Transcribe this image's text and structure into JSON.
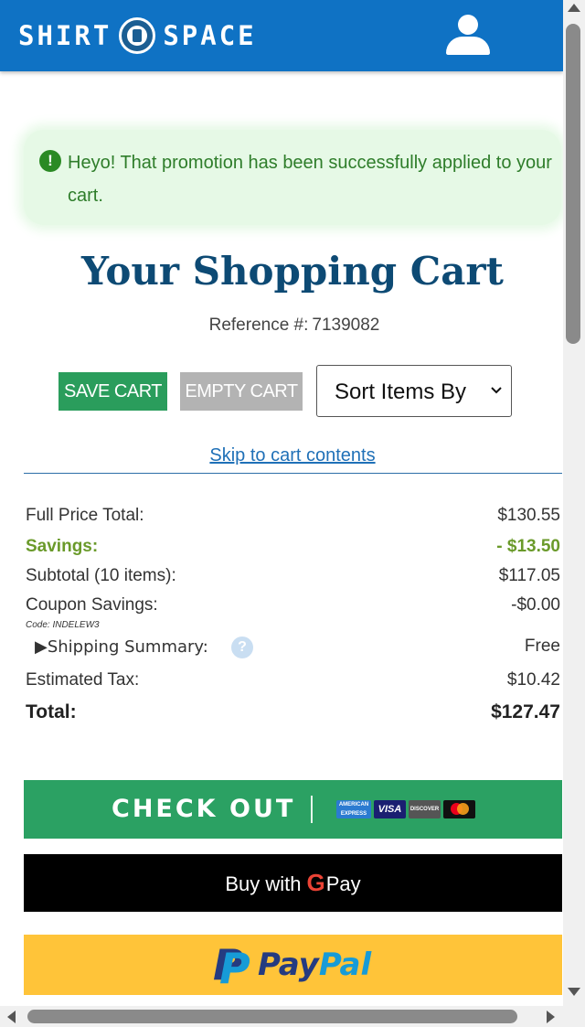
{
  "header": {
    "logo_left": "SHIRT",
    "logo_right": "SPACE",
    "user_icon": "user-account-icon",
    "background_color": "#0f72c4"
  },
  "alert": {
    "icon": "exclamation-circle-icon",
    "message": "Heyo! That promotion has been successfully applied to your cart."
  },
  "cart": {
    "title": "Your Shopping Cart",
    "reference_label": "Reference #:",
    "reference_number": "7139082",
    "save_label": "SAVE CART",
    "empty_label": "EMPTY CART",
    "sort_label": "Sort Items By",
    "skip_link": "Skip to cart contents"
  },
  "summary": {
    "full_price_label": "Full Price Total:",
    "full_price_value": "$130.55",
    "savings_label": "Savings:",
    "savings_value": "- $13.50",
    "subtotal_label": "Subtotal (10 items):",
    "subtotal_value": "$117.05",
    "coupon_label": "Coupon Savings:",
    "coupon_value": "-$0.00",
    "coupon_code": "Code: INDELEW3",
    "shipping_label": "▶Shipping Summary:",
    "shipping_value": "Free",
    "help_icon": "?",
    "tax_label": "Estimated Tax:",
    "tax_value": "$10.42",
    "total_label": "Total:",
    "total_value": "$127.47"
  },
  "payment": {
    "checkout_label": "CHECK OUT",
    "cards": [
      "amex",
      "visa",
      "discover",
      "mastercard"
    ],
    "amex_label": "AMERICAN EXPRESS",
    "visa_label": "VISA",
    "discover_label": "DISCOVER",
    "gpay_prefix": "Buy with",
    "gpay_g": "G",
    "gpay_suffix": "Pay",
    "paypal_pay": "Pay",
    "paypal_pal": "Pal",
    "paypal_mark": "P",
    "checkout_color": "#2ba163",
    "paypal_color": "#ffc439"
  }
}
